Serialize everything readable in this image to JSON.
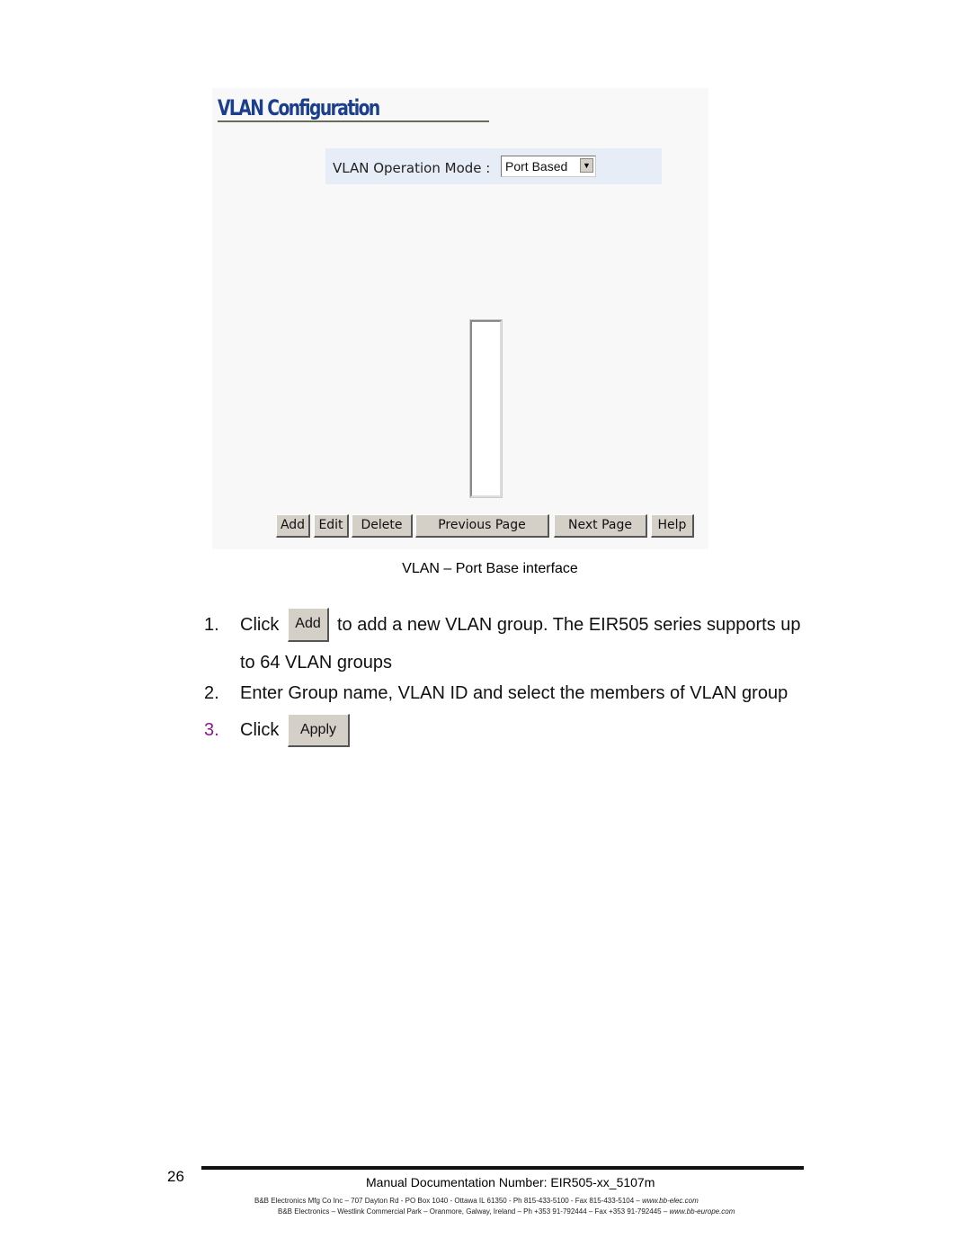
{
  "screenshot": {
    "title": "VLAN Configuration",
    "mode_label": "VLAN Operation Mode :",
    "mode_value": "Port Based",
    "buttons": [
      "Add",
      "Edit",
      "Delete",
      "Previous Page",
      "Next Page",
      "Help"
    ]
  },
  "caption": "VLAN – Port Base interface",
  "steps": [
    {
      "num": "1.",
      "text_before": "Click",
      "button": "Add",
      "text_after": "to add a new VLAN group. The EIR505 series supports up",
      "continuation": "to 64 VLAN groups"
    },
    {
      "num": "2.",
      "text": "Enter Group name, VLAN ID and select the members of VLAN group"
    },
    {
      "num": "3.",
      "text_before": "Click",
      "button": "Apply",
      "num_color": "#8b1a8b"
    }
  ],
  "footer": {
    "page_number": "26",
    "doc_number": "Manual Documentation Number: EIR505-xx_5107m",
    "address_us": "B&B Electronics Mfg Co Inc – 707 Dayton Rd - PO Box 1040 - Ottawa IL 61350 - Ph 815-433-5100 - Fax 815-433-5104 – ",
    "web_us": "www.bb-elec.com",
    "address_eu": "B&B Electronics – Westlink Commercial Park – Oranmore, Galway, Ireland – Ph +353 91-792444 – Fax +353 91-792445 – ",
    "web_eu": "www.bb-europe.com"
  }
}
